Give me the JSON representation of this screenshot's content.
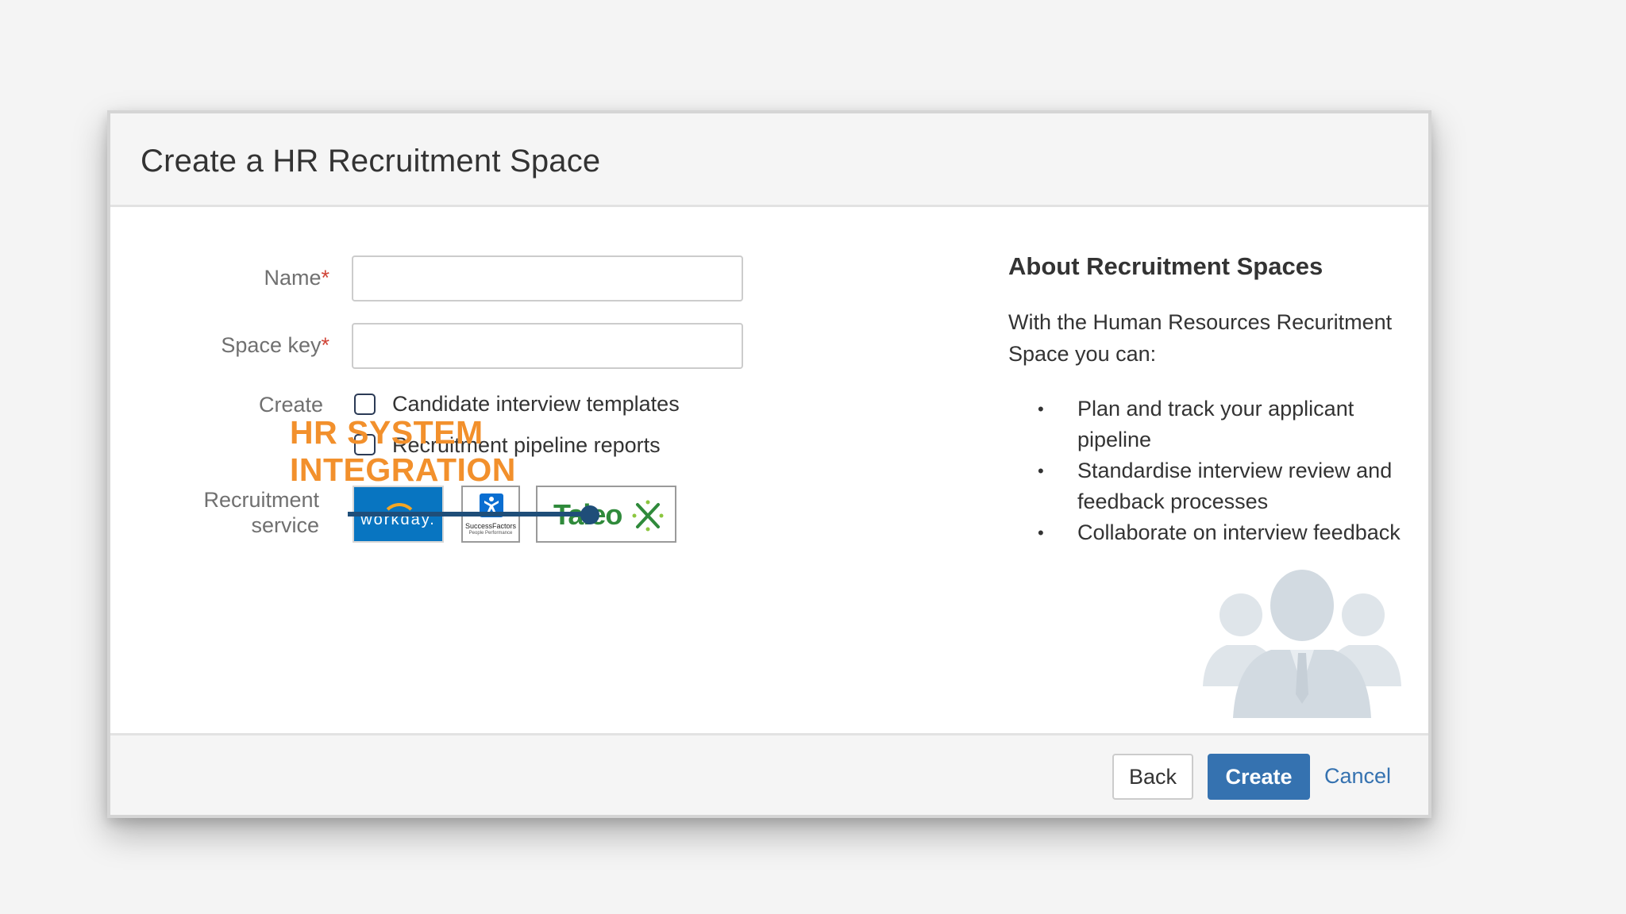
{
  "dialog": {
    "title": "Create a HR Recruitment Space"
  },
  "form": {
    "name_label": "Name",
    "name_value": "",
    "space_key_label": "Space key",
    "space_key_value": "",
    "required_marker": "*",
    "create_label": "Create",
    "checkboxes": [
      {
        "label": "Candidate interview templates",
        "checked": false
      },
      {
        "label": "Recruitment pipeline reports",
        "checked": false
      }
    ],
    "recruitment_service_label_line1": "Recruitment",
    "recruitment_service_label_line2": "service",
    "services": [
      {
        "name": "workday.",
        "icon": "workday-logo"
      },
      {
        "name": "SuccessFactors",
        "subtitle": "People Performance",
        "icon": "successfactors-logo"
      },
      {
        "name": "Taleo",
        "icon": "taleo-logo"
      }
    ]
  },
  "overlay": {
    "text": "HR SYSTEM\nINTEGRATION",
    "color": "#f2902c"
  },
  "about": {
    "title": "About Recruitment Spaces",
    "intro": "With the Human Resources Recuritment Space you can:",
    "bullets": [
      "Plan and track your applicant pipeline",
      "Standardise interview review and feedback processes",
      "Collaborate on interview feedback"
    ],
    "illustration_icon": "people-group-icon"
  },
  "footer": {
    "back_label": "Back",
    "create_label": "Create",
    "cancel_label": "Cancel"
  },
  "colors": {
    "primary": "#3572b0",
    "required": "#d04437",
    "workday_blue": "#0875c1",
    "taleo_green": "#2f8a3b",
    "connector": "#1f4e79"
  }
}
